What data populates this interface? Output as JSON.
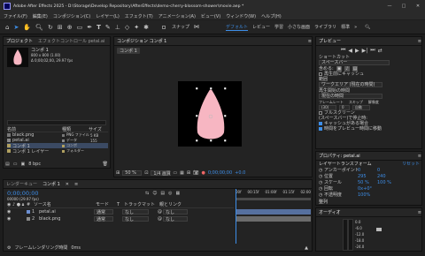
{
  "titlebar": {
    "title": "Adobe After Effects 2025 - D:\\Storage\\Develop Repository\\AfterEffects\\demo-cherry-blossom-shower\\movie.aep *"
  },
  "menubar": [
    "ファイル(F)",
    "編集(E)",
    "コンポジション(C)",
    "レイヤー(L)",
    "エフェクト(T)",
    "アニメーション(A)",
    "ビュー(V)",
    "ウィンドウ(W)",
    "ヘルプ(H)"
  ],
  "toolbar": {
    "snap_label": "スナップ",
    "workspaces": [
      "デフォルト",
      "レビュー",
      "学習",
      "小さな画面",
      "ライブラリ",
      "標準"
    ]
  },
  "project_panel": {
    "tabs": [
      "プロジェクト",
      "エフェクトコントロール petal.ai"
    ],
    "thumb_name": "コンポ 1",
    "thumb_info": [
      "800 x 800 (1.00)",
      "Δ 0;00;02;00, 29.97 fps"
    ],
    "search_placeholder": "",
    "columns": [
      "名前",
      "種類",
      "サイズ"
    ],
    "items": [
      {
        "name": "black.png",
        "type": "PNG ファイル",
        "size": "5 KB",
        "color": "#777777"
      },
      {
        "name": "petal.ai",
        "type": "データ",
        "size": "155",
        "color": "#888888"
      },
      {
        "name": "コンポ 1",
        "type": "コンポ",
        "size": "",
        "color": "#b0a060"
      },
      {
        "name": "コンポ 1 レイヤー",
        "type": "フォルダー",
        "size": "",
        "color": "#b0a060"
      }
    ],
    "footer": "8 bpc"
  },
  "comp_panel": {
    "tab": "コンポジション コンポ 1",
    "comp_chip": "コンポ 1",
    "zoom": "50 %",
    "resolution": "1/4 画質",
    "timecode": "0;00;00;00",
    "exposure": "+0.0"
  },
  "preview_panel": {
    "title": "プレビュー",
    "shortcut_label": "ショートカット",
    "shortcut_value": "スペースバー",
    "include_label": "含める:",
    "cache_label": "再生前にキャッシュ",
    "range_label": "範囲",
    "range_value": "ワークエリア (現在の時間)",
    "playfrom_label": "再生開始の時間",
    "playfrom_value": "現在の時間",
    "framerate_label": "フレームレート",
    "skip_label": "スキップ",
    "resolution_label": "解像度",
    "framerate_value": "(30)",
    "skip_value": "0",
    "res_value": "自動",
    "fullscreen_label": "フルスクリーン",
    "stop_label": "(スペースバー)で停止時:",
    "cache_opt": "キャッシュがある場合",
    "time_opt": "時間をプレビュー時間に移動"
  },
  "properties_panel": {
    "title": "プロパティ: petal.ai",
    "section": "レイヤートランスフォーム",
    "reset": "リセット",
    "props": [
      {
        "name": "アンカーポイント",
        "v1": "0",
        "v2": "0"
      },
      {
        "name": "位置",
        "v1": "295",
        "v2": "240"
      },
      {
        "name": "スケール",
        "v1": "50 %",
        "v2": "100 %"
      },
      {
        "name": "回転",
        "v1": "0x+0°",
        "v2": ""
      },
      {
        "name": "不透明度",
        "v1": "100%",
        "v2": ""
      }
    ],
    "align_label": "整列"
  },
  "audio_panel": {
    "title": "オーディオ",
    "levels": [
      "0.0",
      "-6.0",
      "-12.0",
      "-18.0",
      "-24.0"
    ]
  },
  "timeline": {
    "tabs": [
      "レンダーキュー",
      "コンポ 1"
    ],
    "timecode": "0;00;00;00",
    "fps_small": "00000 (29.97 fps)",
    "columns": [
      "#",
      "ソース名",
      "モード",
      "T",
      "トラックマット",
      "親とリンク"
    ],
    "layers": [
      {
        "num": "1",
        "name": "petal.ai",
        "mode": "通常",
        "track": "なし",
        "parent": "なし",
        "color": "#6c8fd1"
      },
      {
        "num": "2",
        "name": "black.png",
        "mode": "通常",
        "track": "なし",
        "parent": "なし",
        "color": "#8a8a8a"
      }
    ],
    "ruler": [
      "00f",
      "00:15f",
      "01:00f",
      "01:15f",
      "02:00"
    ],
    "footer": "フレームレンダリング時間",
    "render_time": "0ms"
  },
  "colors": {
    "accent": "#3d8ee8",
    "petal": "#f7b6c2",
    "black": "#000000"
  }
}
